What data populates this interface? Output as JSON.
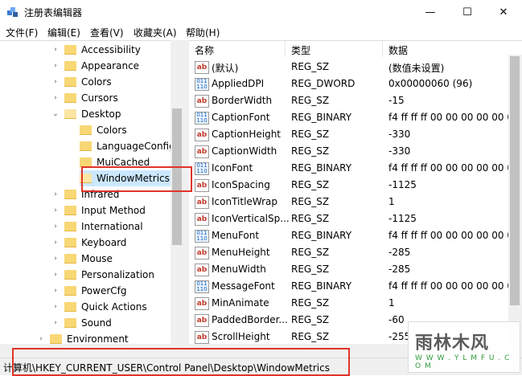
{
  "window": {
    "title": "注册表编辑器",
    "minimize_glyph": "—",
    "maximize_glyph": "☐",
    "close_glyph": "✕"
  },
  "menu": [
    "文件(F)",
    "编辑(E)",
    "查看(V)",
    "收藏夹(A)",
    "帮助(H)"
  ],
  "tree": [
    {
      "label": "Accessibility",
      "expanded": false
    },
    {
      "label": "Appearance",
      "expanded": false
    },
    {
      "label": "Colors",
      "expanded": false
    },
    {
      "label": "Cursors",
      "expanded": false
    },
    {
      "label": "Desktop",
      "expanded": true
    },
    {
      "label": "Colors",
      "expanded": false
    },
    {
      "label": "LanguageConfig",
      "expanded": false
    },
    {
      "label": "MuiCached",
      "expanded": false
    },
    {
      "label": "WindowMetrics",
      "expanded": false,
      "selected": true
    },
    {
      "label": "Infrared",
      "expanded": false
    },
    {
      "label": "Input Method",
      "expanded": false
    },
    {
      "label": "International",
      "expanded": false
    },
    {
      "label": "Keyboard",
      "expanded": false
    },
    {
      "label": "Mouse",
      "expanded": false
    },
    {
      "label": "Personalization",
      "expanded": false
    },
    {
      "label": "PowerCfg",
      "expanded": false
    },
    {
      "label": "Quick Actions",
      "expanded": false
    },
    {
      "label": "Sound",
      "expanded": false
    },
    {
      "label": "Environment",
      "expanded": false
    }
  ],
  "list": {
    "headers": {
      "name": "名称",
      "type": "类型",
      "data": "数据"
    },
    "rows": [
      {
        "icon": "string",
        "name": "(默认)",
        "type": "REG_SZ",
        "data": "(数值未设置)"
      },
      {
        "icon": "binary",
        "name": "AppliedDPI",
        "type": "REG_DWORD",
        "data": "0x00000060 (96)"
      },
      {
        "icon": "string",
        "name": "BorderWidth",
        "type": "REG_SZ",
        "data": "-15"
      },
      {
        "icon": "binary",
        "name": "CaptionFont",
        "type": "REG_BINARY",
        "data": "f4 ff ff ff 00 00 00 00 00 00"
      },
      {
        "icon": "string",
        "name": "CaptionHeight",
        "type": "REG_SZ",
        "data": "-330"
      },
      {
        "icon": "string",
        "name": "CaptionWidth",
        "type": "REG_SZ",
        "data": "-330"
      },
      {
        "icon": "binary",
        "name": "IconFont",
        "type": "REG_BINARY",
        "data": "f4 ff ff ff 00 00 00 00 00 00"
      },
      {
        "icon": "string",
        "name": "IconSpacing",
        "type": "REG_SZ",
        "data": "-1125"
      },
      {
        "icon": "string",
        "name": "IconTitleWrap",
        "type": "REG_SZ",
        "data": "1"
      },
      {
        "icon": "string",
        "name": "IconVerticalSp...",
        "type": "REG_SZ",
        "data": "-1125"
      },
      {
        "icon": "binary",
        "name": "MenuFont",
        "type": "REG_BINARY",
        "data": "f4 ff ff ff 00 00 00 00 00 00"
      },
      {
        "icon": "string",
        "name": "MenuHeight",
        "type": "REG_SZ",
        "data": "-285"
      },
      {
        "icon": "string",
        "name": "MenuWidth",
        "type": "REG_SZ",
        "data": "-285"
      },
      {
        "icon": "binary",
        "name": "MessageFont",
        "type": "REG_BINARY",
        "data": "f4 ff ff ff 00 00 00 00 00 00"
      },
      {
        "icon": "string",
        "name": "MinAnimate",
        "type": "REG_SZ",
        "data": "1"
      },
      {
        "icon": "string",
        "name": "PaddedBorder...",
        "type": "REG_SZ",
        "data": "-60"
      },
      {
        "icon": "string",
        "name": "ScrollHeight",
        "type": "REG_SZ",
        "data": "-255"
      }
    ]
  },
  "status": {
    "path": "计算机\\HKEY_CURRENT_USER\\Control Panel\\Desktop\\WindowMetrics"
  },
  "watermark": {
    "text": "雨林木风",
    "url": "W W W . Y L M F U . C O M"
  },
  "colors": {
    "highlight": "#e0342a",
    "folder": "#f8d775",
    "selection": "#cce8ff"
  }
}
